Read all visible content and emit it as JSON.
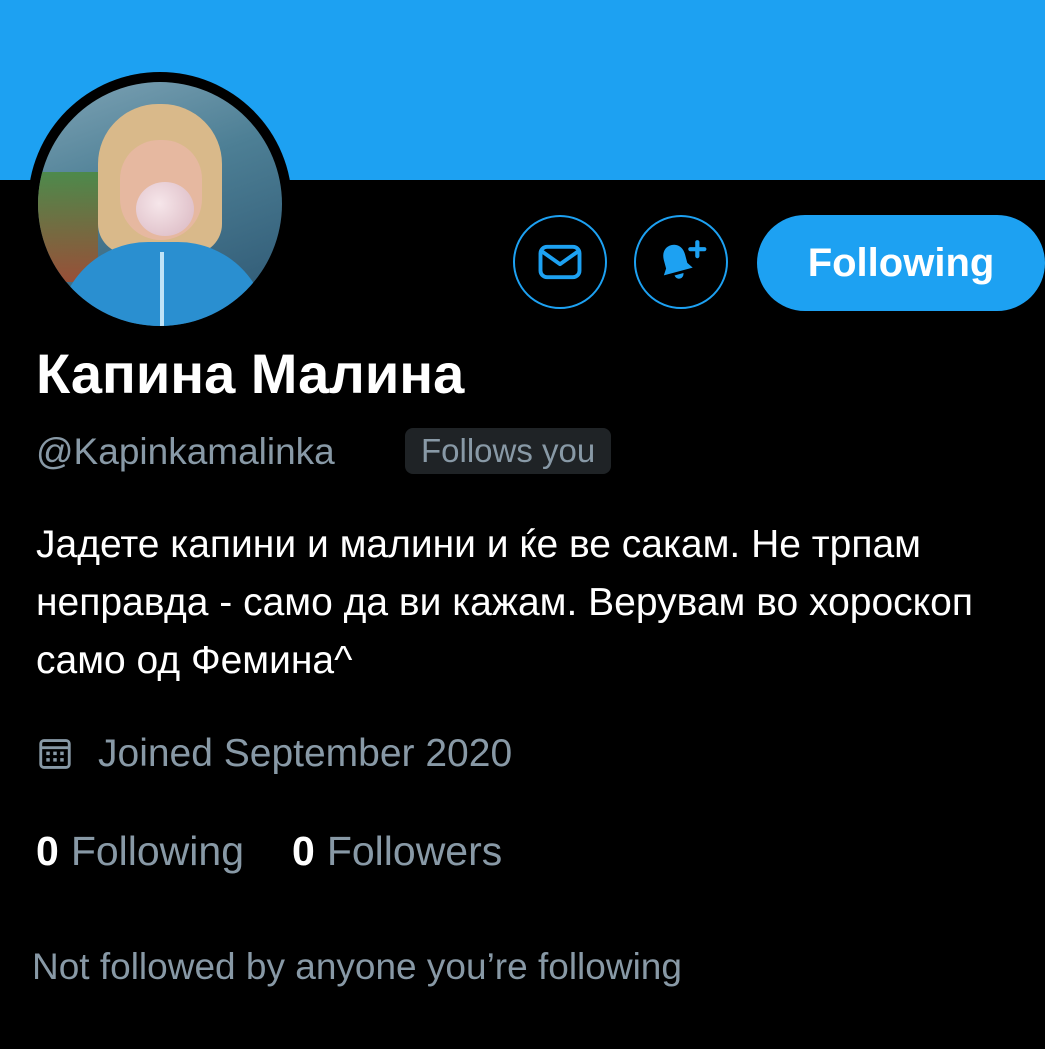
{
  "profile": {
    "display_name": "Капина Малина",
    "handle": "@Kapinkamalinka",
    "follows_you_badge": "Follows you",
    "bio": "Јадете капини и малини и ќе ве сакам. Не трпам неправда - само да ви кажам. Верувам во хороскоп само од Фемина^",
    "joined": "Joined September 2020"
  },
  "actions": {
    "message_icon": "envelope-icon",
    "notify_icon": "bell-plus-icon",
    "follow_label": "Following"
  },
  "stats": {
    "following_count": "0",
    "following_label": "Following",
    "followers_count": "0",
    "followers_label": "Followers"
  },
  "mutuals_text": "Not followed by anyone you’re following",
  "colors": {
    "accent": "#1da1f2",
    "background": "#000000",
    "muted_text": "#8899a6",
    "badge_bg": "#1f2326"
  }
}
